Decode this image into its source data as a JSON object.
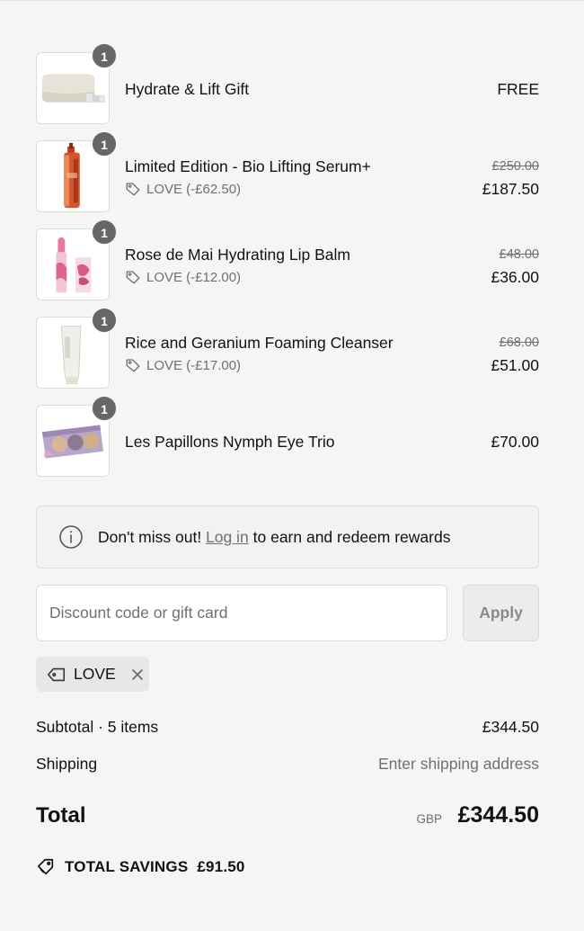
{
  "items": [
    {
      "qty": "1",
      "name": "Hydrate & Lift Gift",
      "price": "FREE"
    },
    {
      "qty": "1",
      "name": "Limited Edition - Bio Lifting Serum+",
      "discount": "LOVE (-£62.50)",
      "original": "£250.00",
      "final": "£187.50"
    },
    {
      "qty": "1",
      "name": "Rose de Mai Hydrating Lip Balm",
      "discount": "LOVE (-£12.00)",
      "original": "£48.00",
      "final": "£36.00"
    },
    {
      "qty": "1",
      "name": "Rice and Geranium Foaming Cleanser",
      "discount": "LOVE (-£17.00)",
      "original": "£68.00",
      "final": "£51.00"
    },
    {
      "qty": "1",
      "name": "Les Papillons Nymph Eye Trio",
      "price": "£70.00"
    }
  ],
  "notice": {
    "before": "Don't miss out!",
    "link": "Log in",
    "after": "to earn and redeem rewards"
  },
  "discount": {
    "placeholder": "Discount code or gift card",
    "apply_label": "Apply",
    "applied_code": "LOVE"
  },
  "summary": {
    "subtotal_label": "Subtotal · 5 items",
    "subtotal_value": "£344.50",
    "shipping_label": "Shipping",
    "shipping_value": "Enter shipping address",
    "total_label": "Total",
    "currency": "GBP",
    "total_value": "£344.50",
    "savings_label": "TOTAL SAVINGS",
    "savings_value": "£91.50"
  }
}
